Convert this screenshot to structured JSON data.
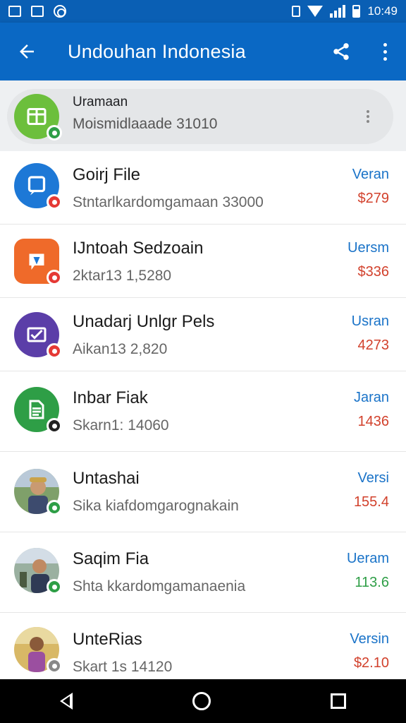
{
  "status_bar": {
    "time": "10:49"
  },
  "app_bar": {
    "title": "Undouhan Indonesia"
  },
  "highlight_row": {
    "title": "Uramaan",
    "subtitle": "Moismidlaaade 31010"
  },
  "rows": [
    {
      "title": "Goirj File",
      "subtitle": "Stntarlkardomgamaan 33000",
      "right_top": "Veran",
      "right_bottom": "$279",
      "right_bottom_color": "#d2412c",
      "icon": "chat-icon",
      "icon_color": "#1d78d6",
      "badge_color": "#e53935"
    },
    {
      "title": "IJntoah Sedzoain",
      "subtitle": "2ktar13 1,5280",
      "right_top": "Uersm",
      "right_bottom": "$336",
      "right_bottom_color": "#d2412c",
      "icon": "map-pin-icon",
      "icon_color": "#ef6a2a",
      "badge_color": "#e53935"
    },
    {
      "title": "Unadarj Unlgr Pels",
      "subtitle": "Aikan13 2,820",
      "right_top": "Usran",
      "right_bottom": "4273",
      "right_bottom_color": "#d2412c",
      "icon": "envelope-check-icon",
      "icon_color": "#5b3ea8",
      "badge_color": "#e53935"
    },
    {
      "title": "Inbar Fiak",
      "subtitle": "Skarn1: 14060",
      "right_top": "Jaran",
      "right_bottom": "1436",
      "right_bottom_color": "#d2412c",
      "icon": "document-icon",
      "icon_color": "#2e9e46",
      "badge_color": "#222222"
    },
    {
      "title": "Untashai",
      "subtitle": "Sika kiafdomgarognakain",
      "right_top": "Versi",
      "right_bottom": "155.4",
      "right_bottom_color": "#d2412c",
      "icon": "avatar-icon",
      "icon_color": "#8a7a5a",
      "badge_color": "#2e9e46"
    },
    {
      "title": "Saqim Fia",
      "subtitle": "Shta kkardomgamanaenia",
      "right_top": "Ueram",
      "right_bottom": "113.6",
      "right_bottom_color": "#2e9e46",
      "icon": "avatar-icon",
      "icon_color": "#5a7a8a",
      "badge_color": "#2e9e46"
    },
    {
      "title": "UnteRias",
      "subtitle": "Skart 1s 14120",
      "right_top": "Versin",
      "right_bottom": "$2.10",
      "right_bottom_color": "#d2412c",
      "icon": "avatar-icon",
      "icon_color": "#c9a24a",
      "badge_color": "#888888"
    }
  ]
}
